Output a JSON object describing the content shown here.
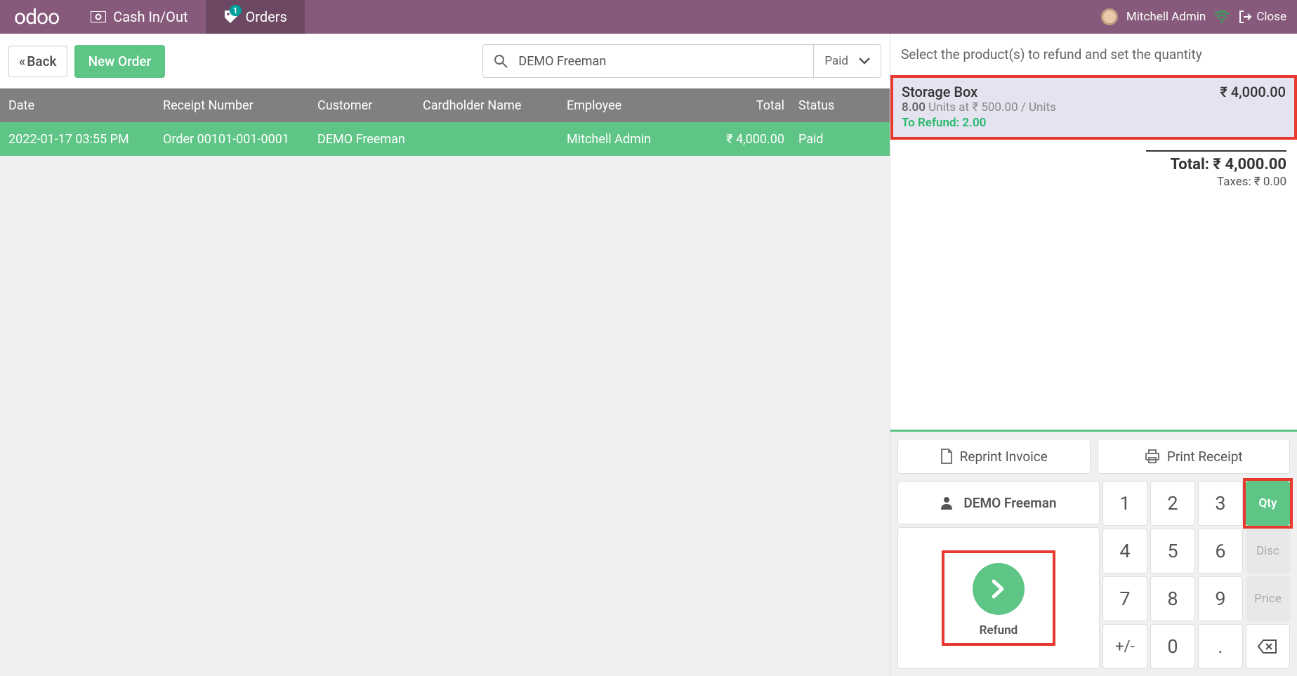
{
  "topbar": {
    "brand": "odoo",
    "cash_label": "Cash In/Out",
    "orders_label": "Orders",
    "orders_badge": "1",
    "user_name": "Mitchell Admin",
    "close_label": "Close"
  },
  "left": {
    "back_label": "Back",
    "new_order_label": "New Order",
    "search_value": "DEMO Freeman",
    "status_value": "Paid",
    "columns": {
      "date": "Date",
      "receipt": "Receipt Number",
      "customer": "Customer",
      "cardholder": "Cardholder Name",
      "employee": "Employee",
      "total": "Total",
      "status": "Status"
    },
    "row": {
      "date": "2022-01-17 03:55 PM",
      "receipt": "Order 00101-001-0001",
      "customer": "DEMO Freeman",
      "cardholder": "",
      "employee": "Mitchell Admin",
      "total": "₹ 4,000.00",
      "status": "Paid"
    }
  },
  "right": {
    "header_text": "Select the product(s) to refund and set the quantity",
    "product": {
      "name": "Storage Box",
      "qty": "8.00",
      "qty_line_rest": " Units at ₹ 500.00 / Units",
      "to_refund": "To Refund: 2.00",
      "price": "₹ 4,000.00"
    },
    "total_label": "Total: ₹ 4,000.00",
    "tax_label": "Taxes: ₹ 0.00",
    "reprint_label": "Reprint Invoice",
    "print_label": "Print Receipt",
    "customer_name": "DEMO Freeman",
    "refund_label": "Refund",
    "numpad": {
      "n1": "1",
      "n2": "2",
      "n3": "3",
      "n4": "4",
      "n5": "5",
      "n6": "6",
      "n7": "7",
      "n8": "8",
      "n9": "9",
      "pm": "+/-",
      "n0": "0",
      "dot": "."
    },
    "mods": {
      "qty": "Qty",
      "disc": "Disc",
      "price": "Price"
    }
  }
}
